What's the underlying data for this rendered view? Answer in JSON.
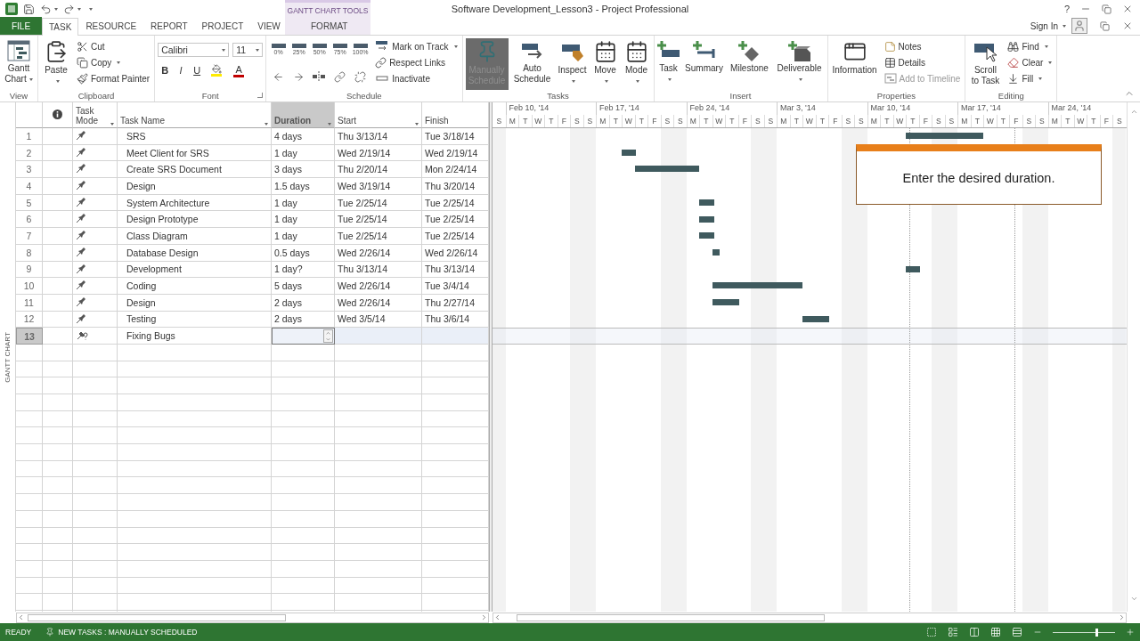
{
  "window": {
    "title": "Software Development_Lesson3 - Project Professional",
    "help": "?"
  },
  "contextual_group": {
    "label": "GANTT CHART TOOLS"
  },
  "tabs": [
    {
      "label": "FILE",
      "kind": "backstage",
      "selected": false
    },
    {
      "label": "TASK",
      "kind": "tab",
      "selected": true
    },
    {
      "label": "RESOURCE",
      "kind": "tab",
      "selected": false
    },
    {
      "label": "REPORT",
      "kind": "tab",
      "selected": false
    },
    {
      "label": "PROJECT",
      "kind": "tab",
      "selected": false
    },
    {
      "label": "VIEW",
      "kind": "tab",
      "selected": false
    },
    {
      "label": "FORMAT",
      "kind": "contextual",
      "selected": false
    }
  ],
  "account": {
    "label": "Sign In"
  },
  "ribbon": [
    {
      "kind": "view",
      "label": "View",
      "items": [
        {
          "label": "Gantt Chart",
          "dropdown": true
        }
      ]
    },
    {
      "kind": "clipboard",
      "label": "Clipboard",
      "items": [
        {
          "label": "Paste",
          "dropdown": true
        },
        {
          "label": "Cut",
          "dropdown": false
        },
        {
          "label": "Copy",
          "dropdown": true
        },
        {
          "label": "Format Painter",
          "dropdown": false
        }
      ]
    },
    {
      "kind": "font",
      "label": "Font",
      "font": "Calibri",
      "size": "11",
      "styles": [
        "B",
        "I",
        "U"
      ],
      "font_color": "A"
    },
    {
      "kind": "schedule",
      "label": "Schedule",
      "percents": [
        "0%",
        "25%",
        "50%",
        "75%",
        "100%"
      ],
      "items": [
        {
          "label": "Mark on Track",
          "dropdown": true
        },
        {
          "label": "Respect Links",
          "dropdown": false
        },
        {
          "label": "Inactivate",
          "dropdown": false
        }
      ]
    },
    {
      "kind": "tasks",
      "label": "Tasks",
      "items": [
        {
          "label": "Manually Schedule",
          "selected": true,
          "dropdown": false
        },
        {
          "label": "Auto Schedule",
          "selected": false,
          "dropdown": false
        },
        {
          "label": "Inspect",
          "selected": false,
          "dropdown": true
        },
        {
          "label": "Move",
          "selected": false,
          "dropdown": true
        },
        {
          "label": "Mode",
          "selected": false,
          "dropdown": true
        }
      ]
    },
    {
      "kind": "insert",
      "label": "Insert",
      "items": [
        {
          "label": "Task",
          "dropdown": true
        },
        {
          "label": "Summary",
          "dropdown": false
        },
        {
          "label": "Milestone",
          "dropdown": false
        },
        {
          "label": "Deliverable",
          "dropdown": true
        }
      ]
    },
    {
      "kind": "properties",
      "label": "Properties",
      "items": [
        {
          "label": "Information",
          "disabled": false
        },
        {
          "label": "Notes",
          "disabled": false
        },
        {
          "label": "Details",
          "disabled": false
        },
        {
          "label": "Add to Timeline",
          "disabled": true
        }
      ]
    },
    {
      "kind": "editing",
      "label": "Editing",
      "items": [
        {
          "label": "Scroll to Task",
          "dropdown": false
        },
        {
          "label": "Find",
          "dropdown": true
        },
        {
          "label": "Clear",
          "dropdown": true
        },
        {
          "label": "Fill",
          "dropdown": true
        }
      ]
    }
  ],
  "view_bar": {
    "label": "GANTT CHART"
  },
  "table": {
    "columns": [
      {
        "kind": "info"
      },
      {
        "kind": "text",
        "label": "Task Mode",
        "filter": true,
        "selected": false
      },
      {
        "kind": "text",
        "label": "Task Name",
        "filter": true,
        "selected": false
      },
      {
        "kind": "text",
        "label": "Duration",
        "filter": true,
        "selected": true
      },
      {
        "kind": "text",
        "label": "Start",
        "filter": true,
        "selected": false
      },
      {
        "kind": "text",
        "label": "Finish",
        "filter": false,
        "selected": false
      }
    ],
    "rows": [
      {
        "id": "1",
        "kind": "manual",
        "name": "SRS",
        "duration": "4 days",
        "start": "Thu 3/13/14",
        "finish": "Tue 3/18/14",
        "selected": false
      },
      {
        "id": "2",
        "kind": "manual",
        "name": "Meet Client for SRS",
        "duration": "1 day",
        "start": "Wed 2/19/14",
        "finish": "Wed 2/19/14",
        "selected": false
      },
      {
        "id": "3",
        "kind": "manual",
        "name": "Create SRS Document",
        "duration": "3 days",
        "start": "Thu 2/20/14",
        "finish": "Mon 2/24/14",
        "selected": false
      },
      {
        "id": "4",
        "kind": "manual",
        "name": "Design",
        "duration": "1.5 days",
        "start": "Wed 3/19/14",
        "finish": "Thu 3/20/14",
        "selected": false
      },
      {
        "id": "5",
        "kind": "manual",
        "name": "System Architecture",
        "duration": "1 day",
        "start": "Tue 2/25/14",
        "finish": "Tue 2/25/14",
        "selected": false
      },
      {
        "id": "6",
        "kind": "manual",
        "name": "Design Prototype",
        "duration": "1 day",
        "start": "Tue 2/25/14",
        "finish": "Tue 2/25/14",
        "selected": false
      },
      {
        "id": "7",
        "kind": "manual",
        "name": "Class Diagram",
        "duration": "1 day",
        "start": "Tue 2/25/14",
        "finish": "Tue 2/25/14",
        "selected": false
      },
      {
        "id": "8",
        "kind": "manual",
        "name": "Database Design",
        "duration": "0.5 days",
        "start": "Wed 2/26/14",
        "finish": "Wed 2/26/14",
        "selected": false
      },
      {
        "id": "9",
        "kind": "manual",
        "name": "Development",
        "duration": "1 day?",
        "start": "Thu 3/13/14",
        "finish": "Thu 3/13/14",
        "selected": false
      },
      {
        "id": "10",
        "kind": "manual",
        "name": "Coding",
        "duration": "5 days",
        "start": "Wed 2/26/14",
        "finish": "Tue 3/4/14",
        "selected": false
      },
      {
        "id": "11",
        "kind": "manual",
        "name": "Design",
        "duration": "2 days",
        "start": "Wed 2/26/14",
        "finish": "Thu 2/27/14",
        "selected": false
      },
      {
        "id": "12",
        "kind": "manual",
        "name": "Testing",
        "duration": "2 days",
        "start": "Wed 3/5/14",
        "finish": "Thu 3/6/14",
        "selected": false
      },
      {
        "id": "13",
        "kind": "manual_unknown",
        "name": "Fixing Bugs",
        "selected": true
      }
    ]
  },
  "timeline": {
    "weeks": [
      "Feb 10, '14",
      "Feb 17, '14",
      "Feb 24, '14",
      "Mar 3, '14",
      "Mar 10, '14",
      "Mar 17, '14",
      "Mar 24, '14"
    ],
    "days": [
      "S",
      "M",
      "T",
      "W",
      "T",
      "F",
      "S",
      "S",
      "M",
      "T",
      "W",
      "T",
      "F",
      "S",
      "S",
      "M",
      "T",
      "W",
      "T",
      "F",
      "S",
      "S",
      "M",
      "T",
      "W",
      "T",
      "F",
      "S",
      "S",
      "M",
      "T",
      "W",
      "T",
      "F",
      "S",
      "S",
      "M",
      "T",
      "W",
      "T",
      "F",
      "S",
      "S",
      "M",
      "T",
      "W",
      "T",
      "F",
      "S"
    ],
    "callout": {
      "text": "Enter the desired duration."
    }
  },
  "status_bar": {
    "ready": "READY",
    "new_tasks": "NEW TASKS : MANUALLY SCHEDULED",
    "zoom": {
      "level": 0.7
    }
  }
}
